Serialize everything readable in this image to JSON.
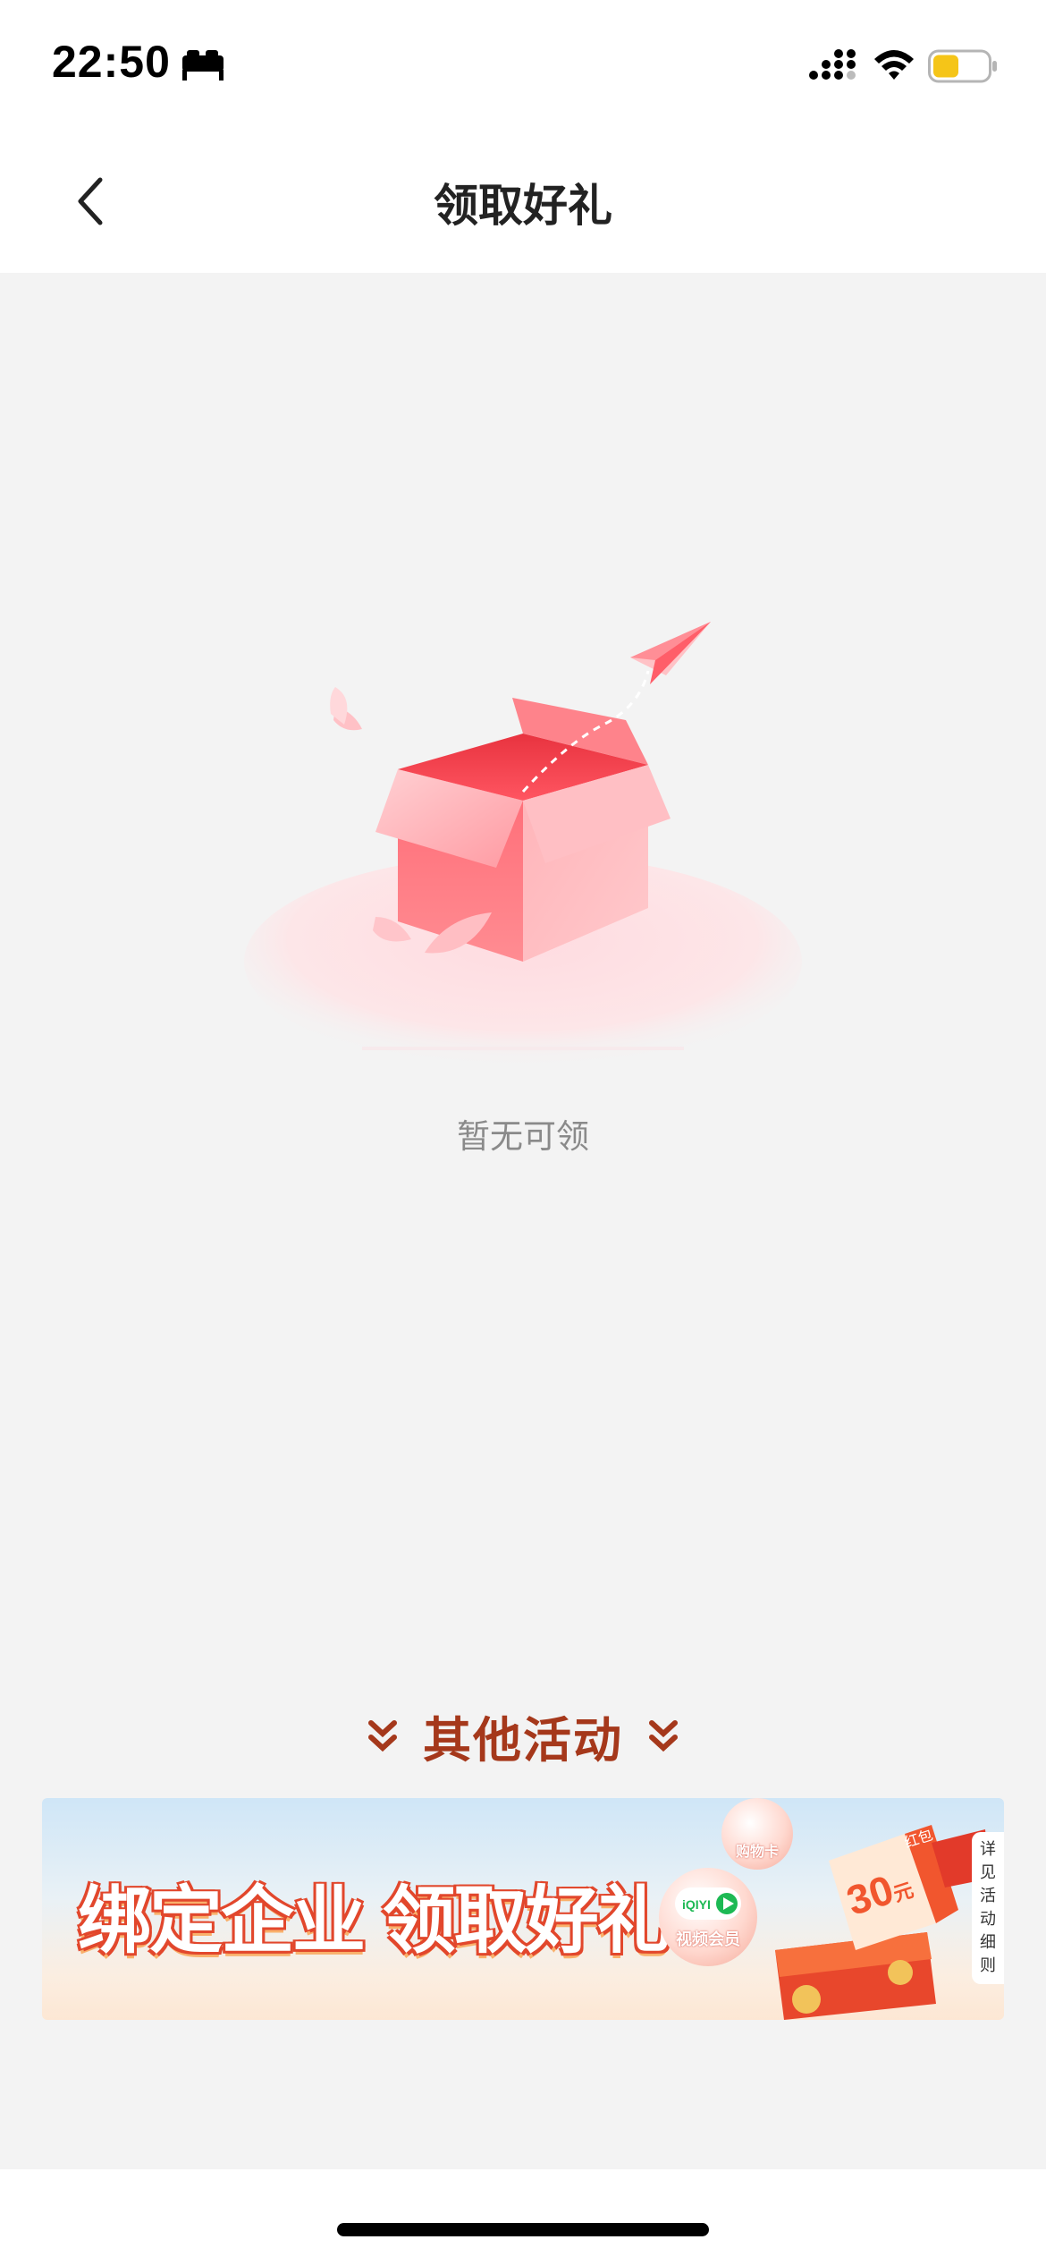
{
  "status_bar": {
    "time": "22:50",
    "icons": [
      "bed-icon",
      "signal-icon",
      "wifi-icon",
      "battery-icon"
    ],
    "battery_color": "#f5c518"
  },
  "nav": {
    "title": "领取好礼",
    "back_icon": "chevron-left-icon"
  },
  "empty_state": {
    "text": "暂无可领",
    "illustration": "empty-box-icon"
  },
  "other_activities": {
    "title": "其他活动"
  },
  "banner": {
    "title": "绑定企业 领取好礼",
    "shopping_card_label": "购物卡",
    "video_vip_label": "视频会员",
    "iqiyi_logo_text": "iQIYI",
    "coupon_amount": "30",
    "coupon_unit": "元",
    "coupon_tag": "红包",
    "side_tab_chars": [
      "详",
      "见",
      "活",
      "动",
      "细",
      "则"
    ]
  },
  "colors": {
    "accent": "#a5381b",
    "banner_title_stroke": "#e2472c",
    "background": "#f3f3f3"
  }
}
